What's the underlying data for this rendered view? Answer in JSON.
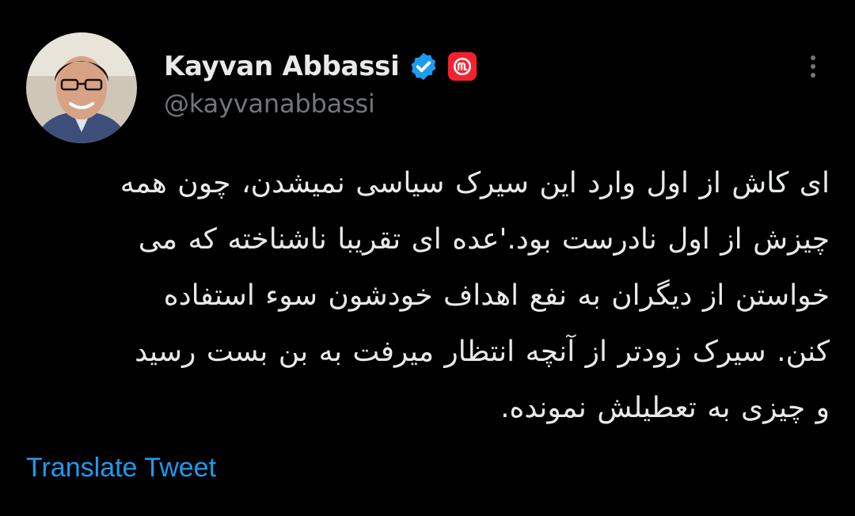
{
  "author": {
    "display_name": "Kayvan Abbassi",
    "handle": "@kayvanabbassi",
    "verified_icon": "verified-badge-icon",
    "affiliate_icon": "affiliate-badge-icon"
  },
  "menu": {
    "icon": "more-icon"
  },
  "tweet": {
    "lines": [
      "ای کاش از اول وارد این سیرک سیاسی نمیشدن، چون همه",
      "چیزش از اول نادرست بود.'عده ای تقریبا ناشناخته که می",
      "خواستن از دیگران به نفع اهداف خودشون سوء استفاده",
      "کنن. سیرک زودتر از آنچه انتظار میرفت به بن بست رسید",
      "و چیزی به تعطیلش نمونده."
    ]
  },
  "actions": {
    "translate_label": "Translate Tweet"
  },
  "colors": {
    "background": "#000000",
    "text": "#e7e9ea",
    "secondary": "#71767b",
    "link": "#1d9bf0",
    "verified": "#1d9bf0",
    "affiliate": "#f4212e"
  }
}
